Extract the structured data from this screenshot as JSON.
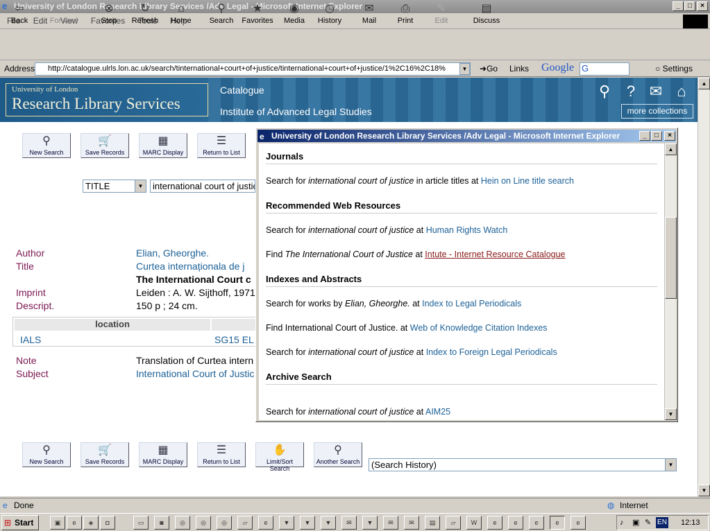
{
  "window": {
    "title": "University of London Research Library Services /Adv Legal - Microsoft Internet Explorer"
  },
  "menu": [
    "File",
    "Edit",
    "View",
    "Favorites",
    "Tools",
    "Help"
  ],
  "toolbar": {
    "back": "Back",
    "forward": "Forward",
    "stop": "Stop",
    "refresh": "Refresh",
    "home": "Home",
    "search": "Search",
    "favorites": "Favorites",
    "media": "Media",
    "history": "History",
    "mail": "Mail",
    "print": "Print",
    "edit": "Edit",
    "discuss": "Discuss"
  },
  "address": {
    "label": "Address",
    "url": "http://catalogue.ulrls.lon.ac.uk/search/tinternational+court+of+justice/tinternational+court+of+justice/1%2C16%2C18%",
    "go": "Go",
    "links": "Links",
    "google": "Google",
    "google_field": "G",
    "settings": "Settings"
  },
  "banner": {
    "logo_small": "University of London",
    "logo_big": "Research Library Services",
    "catalogue": "Catalogue",
    "institute": "Institute of Advanced Legal Studies",
    "more": "more collections"
  },
  "buttons": {
    "new_search": "New Search",
    "save_records": "Save Records",
    "marc_display": "MARC Display",
    "return_to_list": "Return to List",
    "limit_sort": "Limit/Sort Search",
    "another_search": "Another Search"
  },
  "search": {
    "field": "TITLE",
    "query": "international court of justic"
  },
  "record": {
    "author_label": "Author",
    "author": "Elian, Gheorghe.",
    "title_label": "Title",
    "title_link": "Curtea internaționala de j",
    "title_bold": "The International Court c",
    "imprint_label": "Imprint",
    "imprint": "Leiden : A. W. Sijthoff, 1971",
    "descript_label": "Descript.",
    "descript": "150 p ; 24 cm.",
    "location_header": "location",
    "location": "IALS",
    "callno": "SG15 EL",
    "note_label": "Note",
    "note": "Translation of Curtea intern",
    "subject_label": "Subject",
    "subject": "International Court of Justic"
  },
  "history_select": "(Search History)",
  "popup": {
    "title": "University of London Research Library Services /Adv Legal - Microsoft Internet Explorer",
    "sections": [
      {
        "heading": "Journals",
        "rows": [
          {
            "pre": "Search for ",
            "em": "international court of justice",
            "mid": " in article titles at ",
            "link": "Hein on Line title search"
          }
        ]
      },
      {
        "heading": "Recommended Web Resources",
        "rows": [
          {
            "pre": "Search for ",
            "em": "international court of justice",
            "mid": " at ",
            "link": "Human Rights Watch"
          },
          {
            "pre": "Find ",
            "em": "The International Court of Justice",
            "mid": " at ",
            "link": "Intute - Internet Resource Catalogue"
          }
        ]
      },
      {
        "heading": "Indexes and Abstracts",
        "rows": [
          {
            "pre": "Search for works by ",
            "em": "Elian, Gheorghe.",
            "mid": " at ",
            "link": "Index to Legal Periodicals"
          },
          {
            "pre": "Find International Court of Justice.",
            "em": "",
            "mid": " at ",
            "link": "Web of Knowledge Citation Indexes"
          },
          {
            "pre": "Search for ",
            "em": "international court of justice",
            "mid": " at ",
            "link": "Index to Foreign Legal Periodicals"
          }
        ]
      },
      {
        "heading": "Archive Search",
        "rows": [
          {
            "pre": "Search for ",
            "em": "international court of justice",
            "mid": " at ",
            "link": "AIM25"
          }
        ]
      }
    ]
  },
  "status": {
    "text": "Done",
    "zone": "Internet"
  },
  "taskbar": {
    "start": "Start",
    "lang": "EN",
    "time": "12:13"
  }
}
